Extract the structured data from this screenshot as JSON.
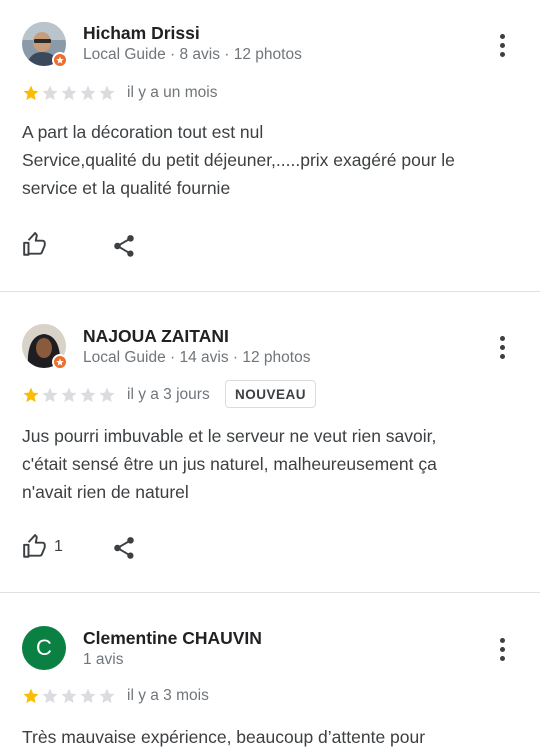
{
  "reviews": [
    {
      "name": "Hicham Drissi",
      "meta": "Local Guide · 8 avis · 12 photos",
      "rating": 1,
      "time": "il y a un mois",
      "badge": "",
      "text_lines": [
        "A part la décoration tout est nul",
        "Service,qualité du petit déjeuner,.....prix exagéré pour le",
        "service et la qualité fournie"
      ],
      "likes": ""
    },
    {
      "name": "NAJOUA ZAITANI",
      "meta": "Local Guide · 14 avis · 12 photos",
      "rating": 1,
      "time": "il y a 3 jours",
      "badge": "NOUVEAU",
      "text_lines": [
        "Jus pourri imbuvable et le serveur ne veut rien savoir,",
        "c'était sensé être un jus naturel, malheureusement ça",
        "n'avait rien de naturel"
      ],
      "likes": "1"
    },
    {
      "name": "Clementine CHAUVIN",
      "meta": "1 avis",
      "avatar_letter": "C",
      "rating": 1,
      "time": "il y a 3 mois",
      "badge": "",
      "text_lines": [
        "Très mauvaise expérience, beaucoup d’attente pour"
      ],
      "likes": ""
    }
  ],
  "colors": {
    "star_filled": "#fbbc04",
    "star_empty": "#dadce0",
    "local_guide_badge": "#ee6c2c",
    "letter_avatar": "#0b8043"
  },
  "icons": [
    "thumbs-up-icon",
    "share-icon",
    "more-vert-icon",
    "star-icon",
    "local-guide-icon"
  ]
}
